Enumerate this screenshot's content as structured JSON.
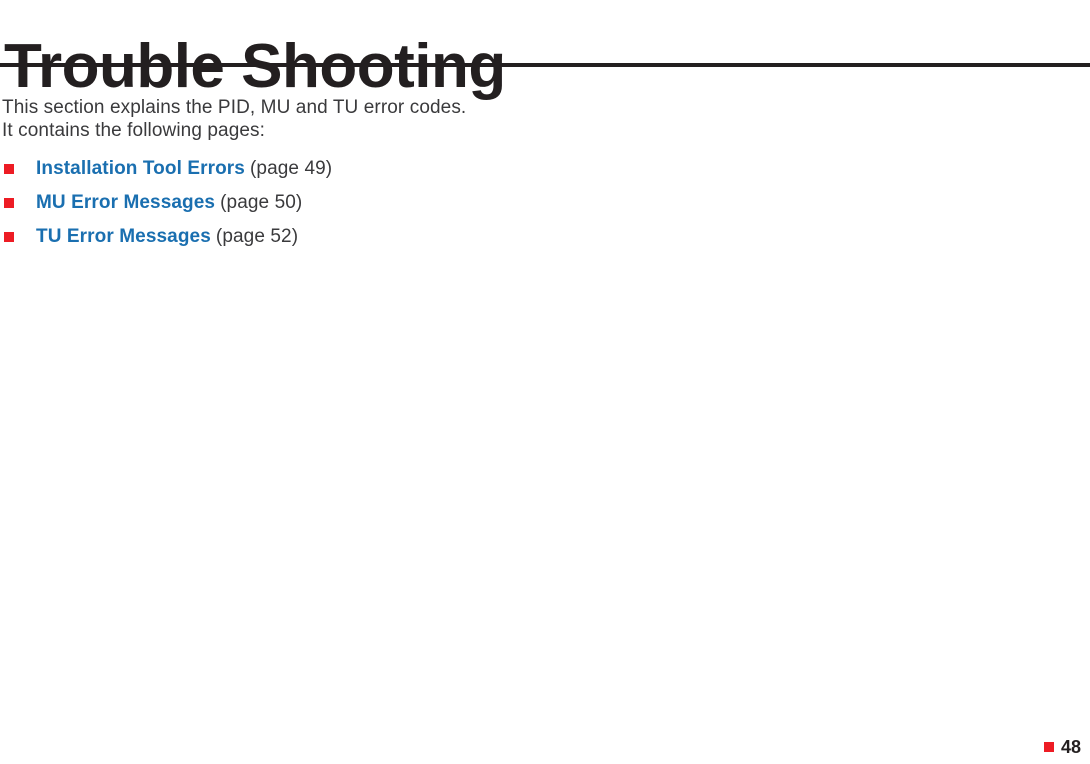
{
  "document": {
    "title": "Trouble Shooting",
    "intro": {
      "line1": "This section explains the PID, MU and TU error codes.",
      "line2": "It contains the following pages:"
    },
    "links": [
      {
        "label": "Installation Tool Errors",
        "page_ref": "(page 49)"
      },
      {
        "label": "MU Error Messages",
        "page_ref": "(page 50)"
      },
      {
        "label": "TU Error Messages",
        "page_ref": "(page 52)"
      }
    ],
    "footer": {
      "page_number": "48",
      "bullet_icon": "red-square-bullet-icon"
    },
    "colors": {
      "bullet_red": "#ed1c24",
      "link_blue": "#1a6fb0",
      "text_dark": "#231f20",
      "body_text": "#3a3a3c",
      "background": "#ffffff"
    }
  }
}
